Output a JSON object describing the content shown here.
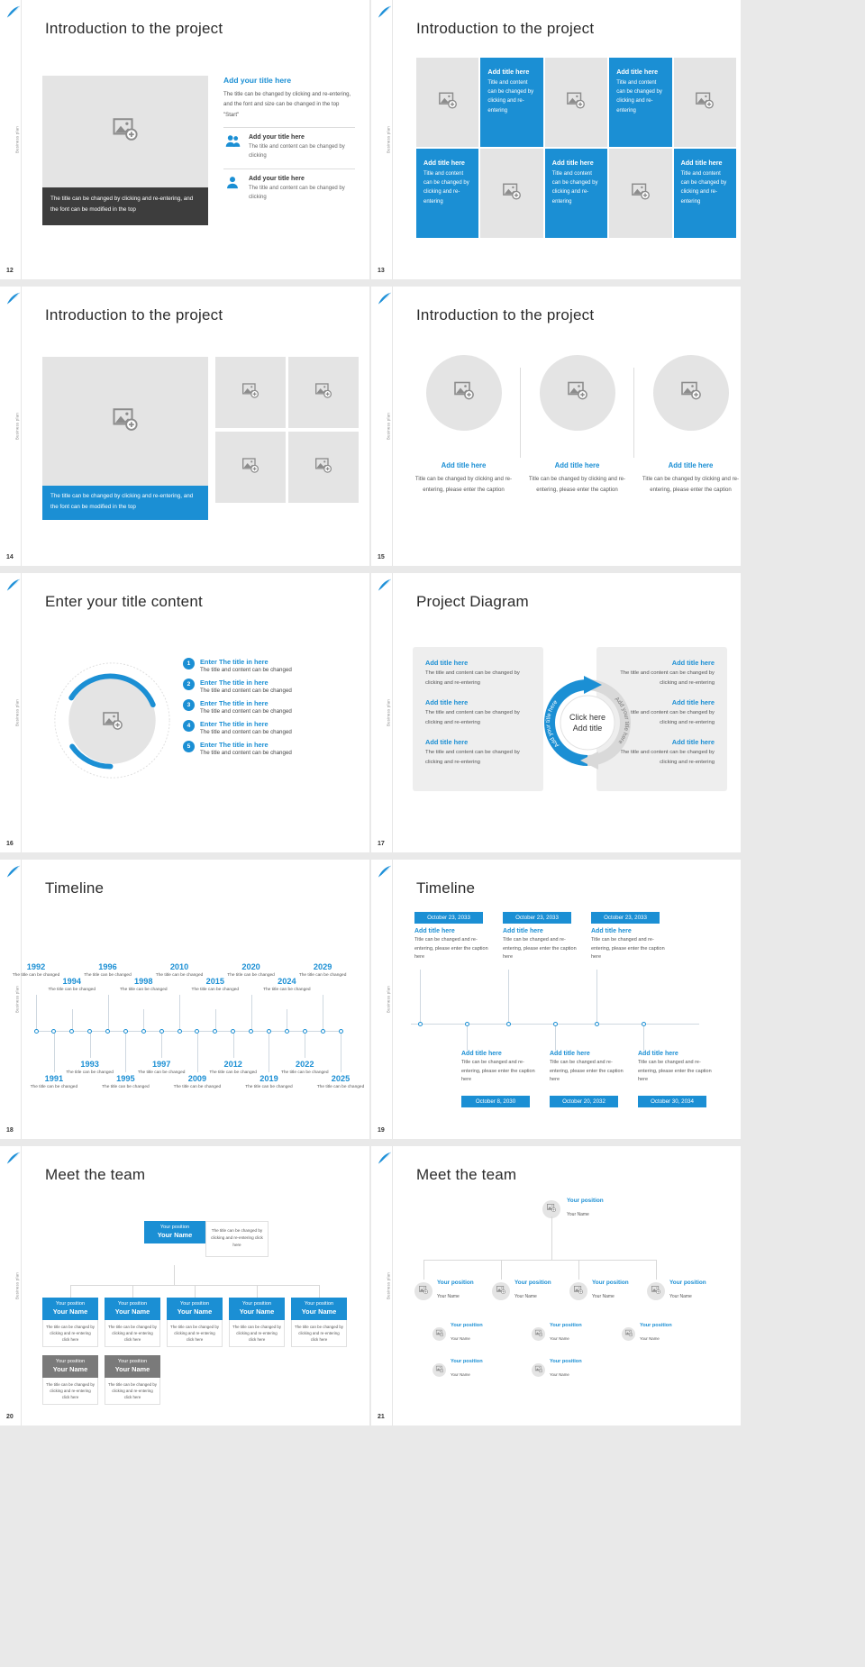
{
  "common": {
    "rail_label": "Business plan",
    "feather_color": "#1e90d8",
    "accent": "#1b8fd4",
    "placeholder_gray": "#e4e4e4",
    "icon": "image-placeholder-icon"
  },
  "slides": [
    {
      "page": "12",
      "title": "Introduction to the project",
      "image_caption": "The title can be changed by clicking and re-entering, and the font can be modified in the top",
      "heading": "Add your title here",
      "paragraph": "The title can be changed by clicking and re-entering, and the font and size can be changed in the top \"Start\"",
      "items": [
        {
          "icon": "two-users-icon",
          "title": "Add your title here",
          "text": "The title and content can be changed by clicking"
        },
        {
          "icon": "single-user-icon",
          "title": "Add your title here",
          "text": "The title and content can be changed by clicking"
        }
      ]
    },
    {
      "page": "13",
      "title": "Introduction to the project",
      "cell_title": "Add title here",
      "cell_text": "Title and content can be changed by clicking and re-entering"
    },
    {
      "page": "14",
      "title": "Introduction to the project",
      "image_caption": "The title can be changed by clicking and re-entering, and the font can be modified in the top"
    },
    {
      "page": "15",
      "title": "Introduction to the project",
      "columns": [
        {
          "title": "Add title here",
          "text": "Title can be changed by clicking and re-entering, please enter the caption"
        },
        {
          "title": "Add title here",
          "text": "Title can be changed by clicking and re-entering, please enter the caption"
        },
        {
          "title": "Add title here",
          "text": "Title can be changed by clicking and re-entering, please enter the caption"
        }
      ]
    },
    {
      "page": "16",
      "title": "Enter your title content",
      "items": [
        {
          "num": "1",
          "title": "Enter The title in here",
          "text": "The title and content can be changed"
        },
        {
          "num": "2",
          "title": "Enter The title in here",
          "text": "The title and content can be changed"
        },
        {
          "num": "3",
          "title": "Enter The title in here",
          "text": "The title and content can be changed"
        },
        {
          "num": "4",
          "title": "Enter The title in here",
          "text": "The title and content can be changed"
        },
        {
          "num": "5",
          "title": "Enter The title in here",
          "text": "The title and content can be changed"
        }
      ]
    },
    {
      "page": "17",
      "title": "Project Diagram",
      "center_line1": "Click here",
      "center_line2": "Add title",
      "arc_label_left": "Add your title here",
      "arc_label_right": "Add your title here",
      "left_blocks": [
        {
          "title": "Add title here",
          "text": "The title and content can be changed by clicking and re-entering"
        },
        {
          "title": "Add title here",
          "text": "The title and content can be changed by clicking and re-entering"
        },
        {
          "title": "Add title here",
          "text": "The title and content can be changed by clicking and re-entering"
        }
      ],
      "right_blocks": [
        {
          "title": "Add title here",
          "text": "The title and content can be changed by clicking and re-entering"
        },
        {
          "title": "Add title here",
          "text": "The title and content can be changed by clicking and re-entering"
        },
        {
          "title": "Add title here",
          "text": "The title and content can be changed by clicking and re-entering"
        }
      ]
    },
    {
      "page": "18",
      "title": "Timeline",
      "note": "The title can be changed",
      "above": [
        {
          "year": "1992",
          "text": "The title can be changed"
        },
        {
          "year": "1994",
          "text": "The title can be changed"
        },
        {
          "year": "1996",
          "text": "The title can be changed"
        },
        {
          "year": "1998",
          "text": "The title can be changed"
        },
        {
          "year": "2010",
          "text": "The title can be changed"
        },
        {
          "year": "2015",
          "text": "The title can be changed"
        },
        {
          "year": "2020",
          "text": "The title can be changed"
        },
        {
          "year": "2024",
          "text": "The title can be changed"
        },
        {
          "year": "2029",
          "text": "The title can be changed"
        }
      ],
      "below": [
        {
          "year": "1991",
          "text": "The title can be changed"
        },
        {
          "year": "1993",
          "text": "The title can be changed"
        },
        {
          "year": "1995",
          "text": "The title can be changed"
        },
        {
          "year": "1997",
          "text": "The title can be changed"
        },
        {
          "year": "2009",
          "text": "The title can be changed"
        },
        {
          "year": "2012",
          "text": "The title can be changed"
        },
        {
          "year": "2019",
          "text": "The title can be changed"
        },
        {
          "year": "2022",
          "text": "The title can be changed"
        },
        {
          "year": "2025",
          "text": "The title can be changed"
        }
      ]
    },
    {
      "page": "19",
      "title": "Timeline",
      "top": [
        {
          "date": "October 23, 2033",
          "title": "Add title here",
          "text": "Title can be changed and re-entering, please enter the caption here"
        },
        {
          "date": "October 23, 2033",
          "title": "Add title here",
          "text": "Title can be changed and re-entering, please enter the caption here"
        },
        {
          "date": "October 23, 2033",
          "title": "Add title here",
          "text": "Title can be changed and re-entering, please enter the caption here"
        }
      ],
      "bottom": [
        {
          "date": "October 8, 2030",
          "title": "Add title here",
          "text": "Title can be changed and re-entering, please enter the caption here"
        },
        {
          "date": "October 20, 2032",
          "title": "Add title here",
          "text": "Title can be changed and re-entering, please enter the caption here"
        },
        {
          "date": "October 30, 2034",
          "title": "Add title here",
          "text": "Title can be changed and re-entering, please enter the caption here"
        }
      ]
    },
    {
      "page": "20",
      "title": "Meet the team",
      "root": {
        "position": "Your position",
        "name": "Your Name"
      },
      "root_note": "The title can be changed by clicking and re-entering click here",
      "blue_row": [
        {
          "position": "Your position",
          "name": "Your Name",
          "text": "The title can be changed by clicking and re-entering click here"
        },
        {
          "position": "Your position",
          "name": "Your Name",
          "text": "The title can be changed by clicking and re-entering click here"
        },
        {
          "position": "Your position",
          "name": "Your Name",
          "text": "The title can be changed by clicking and re-entering click here"
        },
        {
          "position": "Your position",
          "name": "Your Name",
          "text": "The title can be changed by clicking and re-entering click here"
        },
        {
          "position": "Your position",
          "name": "Your Name",
          "text": "The title can be changed by clicking and re-entering click here"
        }
      ],
      "gray_row": [
        {
          "position": "Your position",
          "name": "Your Name",
          "text": "The title can be changed by clicking and re-entering click here"
        },
        {
          "position": "Your position",
          "name": "Your Name",
          "text": "The title can be changed by clicking and re-entering click here"
        }
      ]
    },
    {
      "page": "21",
      "title": "Meet the team",
      "root": {
        "position": "Your position",
        "name": "Your Name"
      },
      "level2": [
        {
          "position": "Your position",
          "name": "Your Name"
        },
        {
          "position": "Your position",
          "name": "Your Name"
        },
        {
          "position": "Your position",
          "name": "Your Name"
        },
        {
          "position": "Your position",
          "name": "Your Name"
        }
      ],
      "level3": [
        {
          "position": "Your position",
          "name": "Your Name"
        },
        {
          "position": "Your position",
          "name": "Your Name"
        },
        {
          "position": "Your position",
          "name": "Your Name"
        },
        {
          "position": "Your position",
          "name": "Your Name"
        },
        {
          "position": "Your position",
          "name": "Your Name"
        }
      ]
    }
  ]
}
